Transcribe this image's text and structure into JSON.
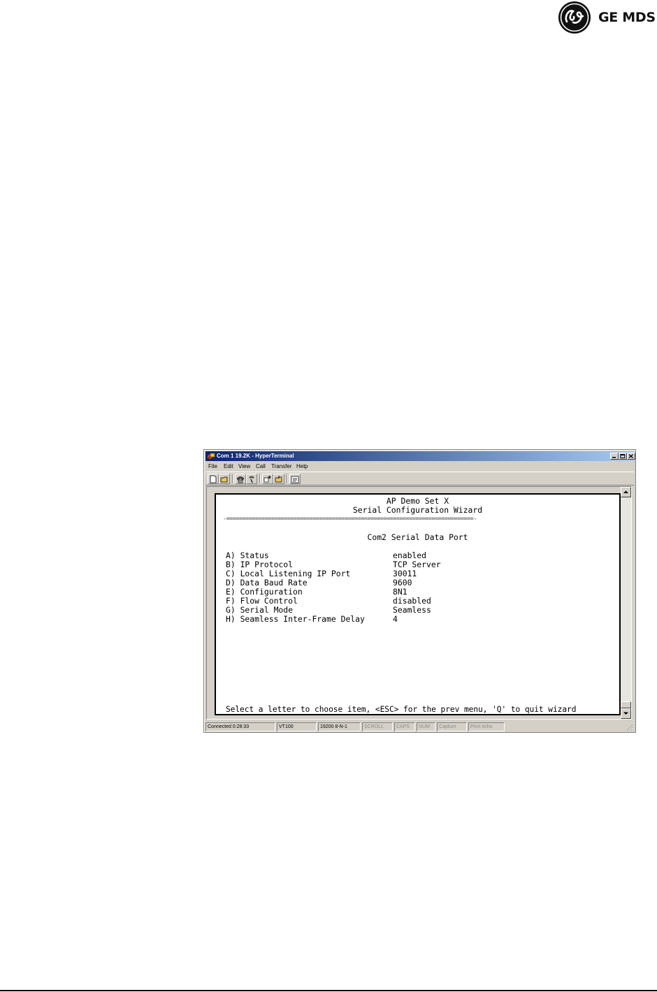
{
  "logo": {
    "monogram": "GE",
    "text": "GE MDS"
  },
  "window": {
    "title": "Com 1 19.2K - HyperTerminal",
    "menu": [
      "File",
      "Edit",
      "View",
      "Call",
      "Transfer",
      "Help"
    ],
    "toolbar_icons": [
      "new-icon",
      "open-icon",
      "phone-icon",
      "disconnect-icon",
      "send-icon",
      "receive-icon",
      "properties-icon"
    ]
  },
  "terminal": {
    "heading": "AP Demo Set X",
    "subheading": "Serial Configuration Wizard",
    "separator": "-=============================================================================-",
    "section": "Com2 Serial Data Port",
    "items": [
      {
        "label": "A) Status",
        "value": "enabled"
      },
      {
        "label": "B) IP Protocol",
        "value": "TCP Server"
      },
      {
        "label": "C) Local Listening IP Port",
        "value": "30011"
      },
      {
        "label": "D) Data Baud Rate",
        "value": "9600"
      },
      {
        "label": "E) Configuration",
        "value": "8N1"
      },
      {
        "label": "F) Flow Control",
        "value": "disabled"
      },
      {
        "label": "G) Serial Mode",
        "value": "Seamless"
      },
      {
        "label": "H) Seamless Inter-Frame Delay",
        "value": "4"
      }
    ],
    "prompt": "Select a letter to choose item, <ESC> for the prev menu, 'Q' to quit wizard"
  },
  "status_bar": {
    "connected": "Connected 0:28:33",
    "emulation": "VT100",
    "settings": "19200 8-N-1",
    "scroll": "SCROLL",
    "caps": "CAPS",
    "num": "NUM",
    "capture": "Capture",
    "echo": "Print echo"
  }
}
